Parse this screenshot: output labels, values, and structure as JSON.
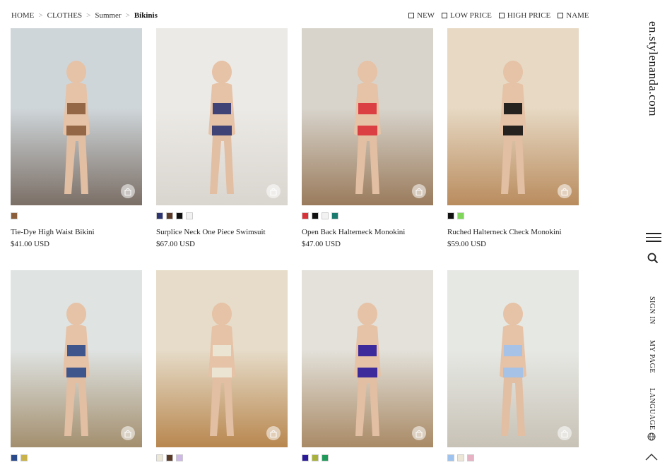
{
  "breadcrumb": {
    "items": [
      "HOME",
      "CLOTHES",
      "Summer",
      "Bikinis"
    ],
    "separator": ">"
  },
  "sort_options": [
    "NEW",
    "LOW PRICE",
    "HIGH PRICE",
    "NAME"
  ],
  "side": {
    "domain": "en.stylenanda.com",
    "sign_in": "SIGN IN",
    "my_page": "MY PAGE",
    "language": "LANGUAGE"
  },
  "icons": {
    "menu": "hamburger-icon",
    "search": "search-icon",
    "globe": "globe-icon",
    "top": "chevron-up-icon",
    "bag": "shopping-bag-icon"
  },
  "products": [
    {
      "name": "Tie-Dye High Waist Bikini",
      "price": "$41.00 USD",
      "colors": [
        "#8b5e3c"
      ],
      "tones": [
        "#cfd6da",
        "#7b6f66"
      ]
    },
    {
      "name": "Surplice Neck One Piece Swimsuit",
      "price": "$67.00 USD",
      "colors": [
        "#2d3570",
        "#5a3a28",
        "#111111",
        "#f2f2f2"
      ],
      "tones": [
        "#eceae6",
        "#d9d5cf"
      ]
    },
    {
      "name": "Open Back Halterneck Monokini",
      "price": "$47.00 USD",
      "colors": [
        "#d93038",
        "#111111",
        "#f2f2f2",
        "#1b7a6e"
      ],
      "tones": [
        "#d8d4cc",
        "#9a7b5c"
      ]
    },
    {
      "name": "Ruched Halterneck Check Monokini",
      "price": "$59.00 USD",
      "colors": [
        "#111111",
        "#7fd65a"
      ],
      "tones": [
        "#e7d9c4",
        "#b98c5e"
      ]
    },
    {
      "name": "",
      "price": "",
      "colors": [
        "#2b4a8a",
        "#c9b24a"
      ],
      "tones": [
        "#dfe3e2",
        "#a38f6e"
      ]
    },
    {
      "name": "",
      "price": "",
      "colors": [
        "#ece8d8",
        "#5a3a28",
        "#cdb8e6"
      ],
      "tones": [
        "#e6dcc9",
        "#b8874f"
      ]
    },
    {
      "name": "",
      "price": "",
      "colors": [
        "#2a1a9a",
        "#a8b23a",
        "#1f9a5a"
      ],
      "tones": [
        "#e3e1da",
        "#a98a66"
      ]
    },
    {
      "name": "",
      "price": "",
      "colors": [
        "#9ec3ee",
        "#ece6d6",
        "#e6b2c4"
      ],
      "tones": [
        "#e6e8e4",
        "#c8c2b6"
      ]
    }
  ]
}
